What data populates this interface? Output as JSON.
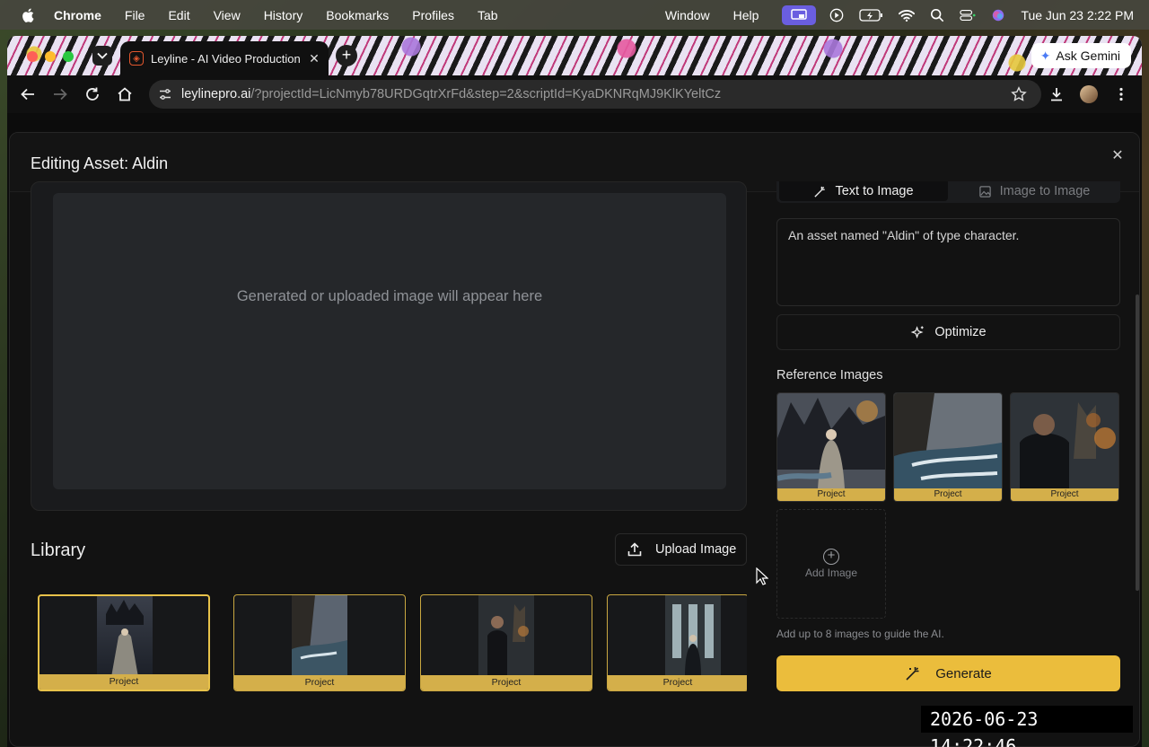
{
  "menubar": {
    "app": "Chrome",
    "items": [
      "File",
      "Edit",
      "View",
      "History",
      "Bookmarks",
      "Profiles",
      "Tab"
    ],
    "right_items": [
      "Window",
      "Help"
    ],
    "clock": "Tue Jun 23  2:22 PM"
  },
  "browser": {
    "tab_title": "Leyline - AI Video Production",
    "url_host": "leylinepro.ai",
    "url_rest": "/?projectId=LicNmyb78URDGqtrXrFd&step=2&scriptId=KyaDKNRqMJ9KlKYeltCz",
    "ask_gemini": "Ask Gemini"
  },
  "modal": {
    "title": "Editing Asset: Aldin",
    "preview_placeholder": "Generated or uploaded image will appear here",
    "library_title": "Library",
    "upload_label": "Upload Image",
    "library_items": [
      {
        "label": "Project"
      },
      {
        "label": "Project"
      },
      {
        "label": "Project"
      },
      {
        "label": "Project"
      }
    ]
  },
  "panel": {
    "tab_text_to_image": "Text to Image",
    "tab_image_to_image": "Image to Image",
    "prompt": "An asset named \"Aldin\" of type character.",
    "optimize_label": "Optimize",
    "reference_title": "Reference Images",
    "reference_items": [
      {
        "label": "Project"
      },
      {
        "label": "Project"
      },
      {
        "label": "Project"
      }
    ],
    "add_image_label": "Add Image",
    "hint": "Add up to 8 images to guide the AI.",
    "generate_label": "Generate"
  },
  "overlay": {
    "timestamp": "2026-06-23  14:22:46"
  },
  "colors": {
    "accent": "#ebbd3c",
    "badge": "#d4af4a"
  }
}
